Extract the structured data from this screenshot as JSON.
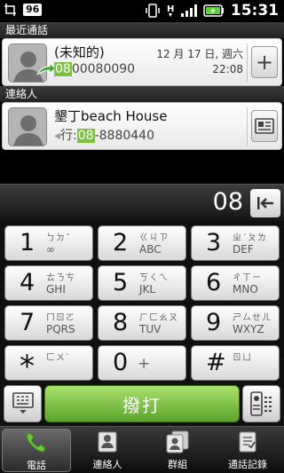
{
  "status_bar": {
    "badge": "96",
    "time": "15:31"
  },
  "recent": {
    "header": "最近通話",
    "name": "(未知的)",
    "number_match": "08",
    "number_rest": "00080090",
    "date": "12 月 17 日, 週六",
    "time": "22:08",
    "add_label": "+"
  },
  "contacts": {
    "header": "連絡人",
    "name": "墾丁beach House",
    "number_prefix": "行:",
    "number_match": "08",
    "number_rest": "-8880440"
  },
  "dialer": {
    "entered": "08"
  },
  "keys": [
    {
      "digit": "1",
      "zhuyin": "ㄅㄉˇ",
      "letters": "∞"
    },
    {
      "digit": "2",
      "zhuyin": "ㄍㄐㄗ",
      "letters": "ABC"
    },
    {
      "digit": "3",
      "zhuyin": "ㄓˊㄆㄌ",
      "letters": "DEF"
    },
    {
      "digit": "4",
      "zhuyin": "ㄊㄋㄘ",
      "letters": "GHI"
    },
    {
      "digit": "5",
      "zhuyin": "ㄎㄑㄟ",
      "letters": "JKL"
    },
    {
      "digit": "6",
      "zhuyin": "ㄔㄒㄧ",
      "letters": "MNO"
    },
    {
      "digit": "7",
      "zhuyin": "ㄇㄖㄛ",
      "letters": "PQRS"
    },
    {
      "digit": "8",
      "zhuyin": "ㄏㄈㄠㄡ",
      "letters": "TUV"
    },
    {
      "digit": "9",
      "zhuyin": "ㄕㄙㄝㄦ",
      "letters": "WXYZ"
    },
    {
      "digit": "*",
      "zhuyin": "ㄈㄨˋ",
      "letters": ""
    },
    {
      "digit": "0",
      "zhuyin": "",
      "letters": "+"
    },
    {
      "digit": "#",
      "zhuyin": "ㄖㄩ",
      "letters": ""
    }
  ],
  "call_button": "撥打",
  "tabs": [
    {
      "label": "電話",
      "icon": "phone-icon",
      "active": true
    },
    {
      "label": "連絡人",
      "icon": "contacts-icon",
      "active": false
    },
    {
      "label": "群組",
      "icon": "groups-icon",
      "active": false
    },
    {
      "label": "通話記錄",
      "icon": "call-history-icon",
      "active": false
    }
  ]
}
